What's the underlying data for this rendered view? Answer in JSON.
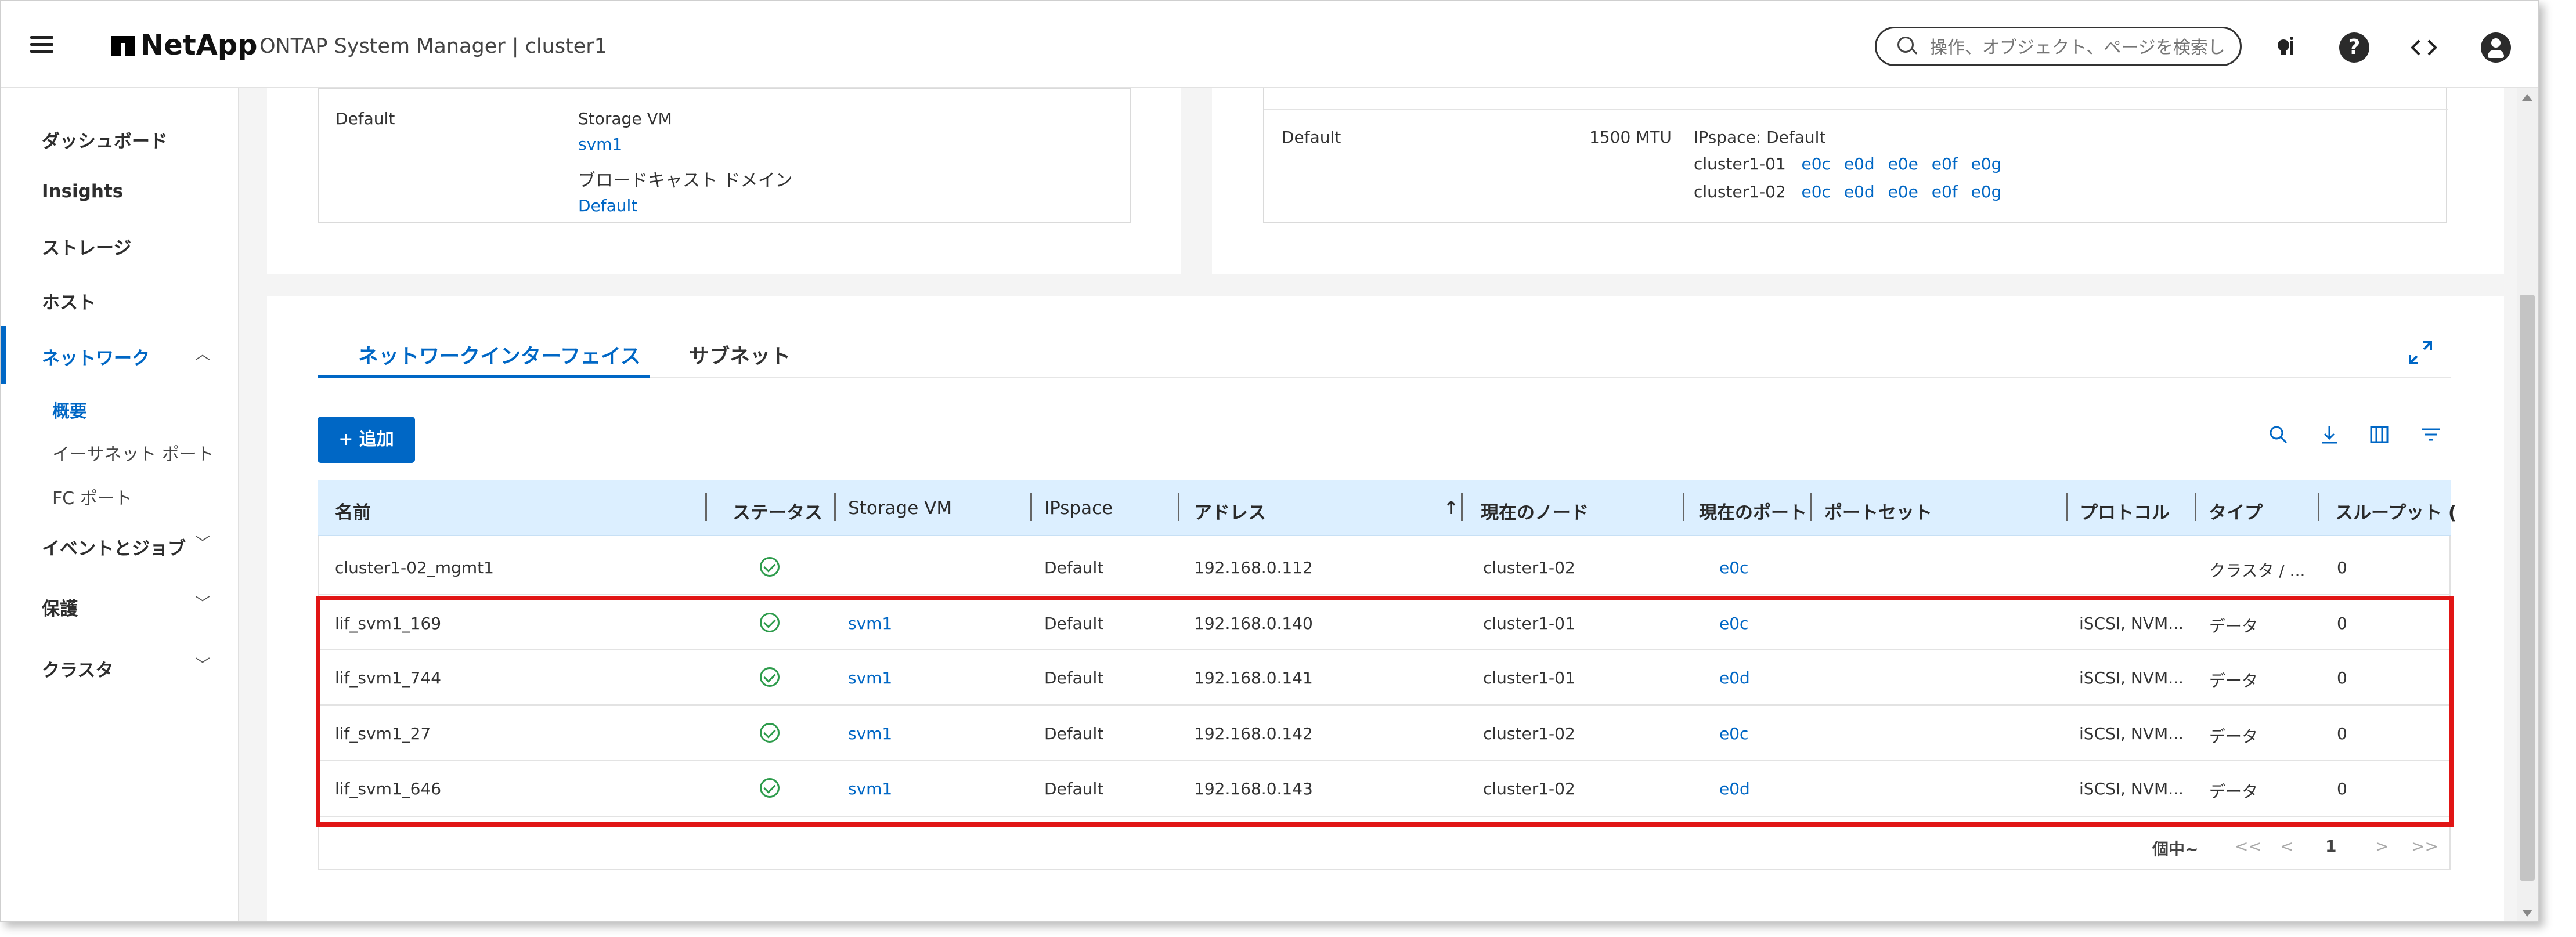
{
  "header": {
    "brand": "NetApp",
    "product": "ONTAP System Manager  |  cluster1",
    "search_placeholder": "操作、オブジェクト、ページを検索し",
    "icons": [
      "menu-icon",
      "bulb-icon",
      "help-icon",
      "code-icon",
      "user-icon"
    ]
  },
  "sidebar": {
    "items": [
      {
        "label": "ダッシュボード"
      },
      {
        "label": "Insights"
      },
      {
        "label": "ストレージ"
      },
      {
        "label": "ホスト"
      },
      {
        "label": "ネットワーク",
        "expanded": true,
        "active": true
      },
      {
        "label": "概要",
        "sub": true,
        "active": true
      },
      {
        "label": "イーサネット ポート",
        "sub": true
      },
      {
        "label": "FC ポート",
        "sub": true
      },
      {
        "label": "イベントとジョブ"
      },
      {
        "label": "保護"
      },
      {
        "label": "クラスタ"
      }
    ]
  },
  "top_left_card": {
    "name": "Default",
    "storage_vm_label": "Storage VM",
    "storage_vm_value": "svm1",
    "broadcast_label": "ブロードキャスト ドメイン",
    "broadcast_value": "Default"
  },
  "top_right_card": {
    "name": "Default",
    "mtu": "1500 MTU",
    "ipspace": "IPspace: Default",
    "nodes": [
      {
        "node": "cluster1-01",
        "ports": [
          "e0c",
          "e0d",
          "e0e",
          "e0f",
          "e0g"
        ]
      },
      {
        "node": "cluster1-02",
        "ports": [
          "e0c",
          "e0d",
          "e0e",
          "e0f",
          "e0g"
        ]
      }
    ]
  },
  "tabs": [
    {
      "label": "ネットワークインターフェイス",
      "active": true
    },
    {
      "label": "サブネット",
      "active": false
    }
  ],
  "add_button": "+ 追加",
  "table": {
    "columns": [
      "名前",
      "ステータス",
      "Storage VM",
      "IPspace",
      "アドレス",
      "現在のノード",
      "現在のポート",
      "ポートセット",
      "プロトコル",
      "タイプ",
      "スループット ("
    ],
    "sort_indicator": "↑",
    "rows": [
      {
        "name": "cluster1-02_mgmt1",
        "status": "ok",
        "svm": "",
        "ipspace": "Default",
        "address": "192.168.0.112",
        "node": "cluster1-02",
        "port": "e0c",
        "portset": "",
        "protocol": "",
        "type": "クラスタ / ...",
        "throughput": "0"
      },
      {
        "name": "lif_svm1_169",
        "status": "ok",
        "svm": "svm1",
        "ipspace": "Default",
        "address": "192.168.0.140",
        "node": "cluster1-01",
        "port": "e0c",
        "portset": "",
        "protocol": "iSCSI, NVM...",
        "type": "データ",
        "throughput": "0"
      },
      {
        "name": "lif_svm1_744",
        "status": "ok",
        "svm": "svm1",
        "ipspace": "Default",
        "address": "192.168.0.141",
        "node": "cluster1-01",
        "port": "e0d",
        "portset": "",
        "protocol": "iSCSI, NVM...",
        "type": "データ",
        "throughput": "0"
      },
      {
        "name": "lif_svm1_27",
        "status": "ok",
        "svm": "svm1",
        "ipspace": "Default",
        "address": "192.168.0.142",
        "node": "cluster1-02",
        "port": "e0c",
        "portset": "",
        "protocol": "iSCSI, NVM...",
        "type": "データ",
        "throughput": "0"
      },
      {
        "name": "lif_svm1_646",
        "status": "ok",
        "svm": "svm1",
        "ipspace": "Default",
        "address": "192.168.0.143",
        "node": "cluster1-02",
        "port": "e0d",
        "portset": "",
        "protocol": "iSCSI, NVM...",
        "type": "データ",
        "throughput": "0"
      }
    ]
  },
  "pagination": {
    "summary": "個中~",
    "first": "<<",
    "prev": "<",
    "page": "1",
    "next": ">",
    "last": ">>"
  },
  "colors": {
    "accent": "#0067c5",
    "header_row": "#dcefff",
    "status_ok": "#2e9c4c",
    "highlight": "#e11515"
  }
}
